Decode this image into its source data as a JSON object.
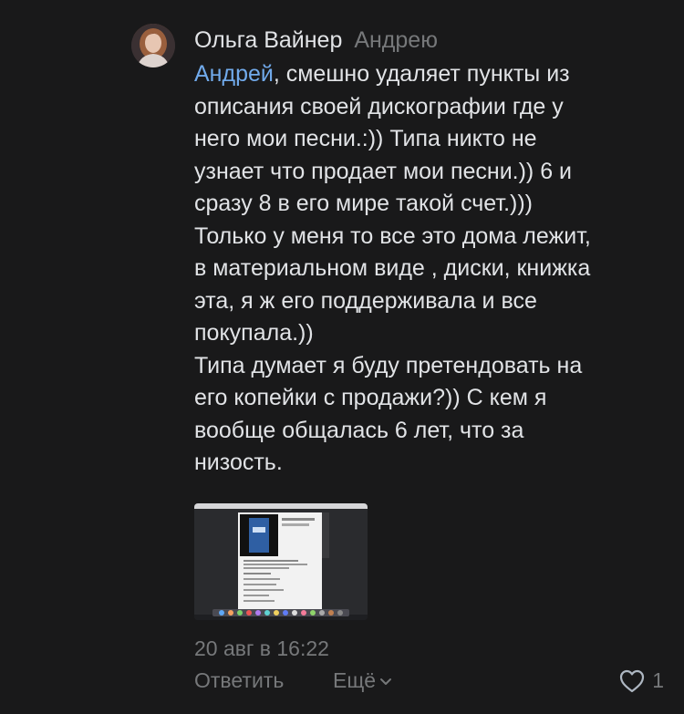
{
  "comment": {
    "author": "Ольга Вайнер",
    "reply_to": "Андрею",
    "mention": "Андрей",
    "text_after_mention": ", смешно удаляет пункты из\nописания своей дискографии где у\nнего мои песни.:)) Типа никто не\nузнает что продает мои песни.)) 6 и\nсразу 8 в его мире такой счет.)))\nТолько у меня то все это дома лежит,\nв материальном виде , диски, книжка\nэта, я ж его поддерживала и все\nпокупала.))\nТипа думает я буду претендовать на\nего копейки с продажи?)) С кем я\nвообще общалась 6 лет, что за\nнизость.",
    "date": "20 авг в 16:22",
    "attachment_icon": "screenshot-thumbnail"
  },
  "actions": {
    "reply_label": "Ответить",
    "more_label": "Ещё",
    "likes_count": "1"
  },
  "colors": {
    "background": "#19191a",
    "text": "#e1e3e6",
    "secondary": "#76787a",
    "link": "#71aaeb"
  }
}
